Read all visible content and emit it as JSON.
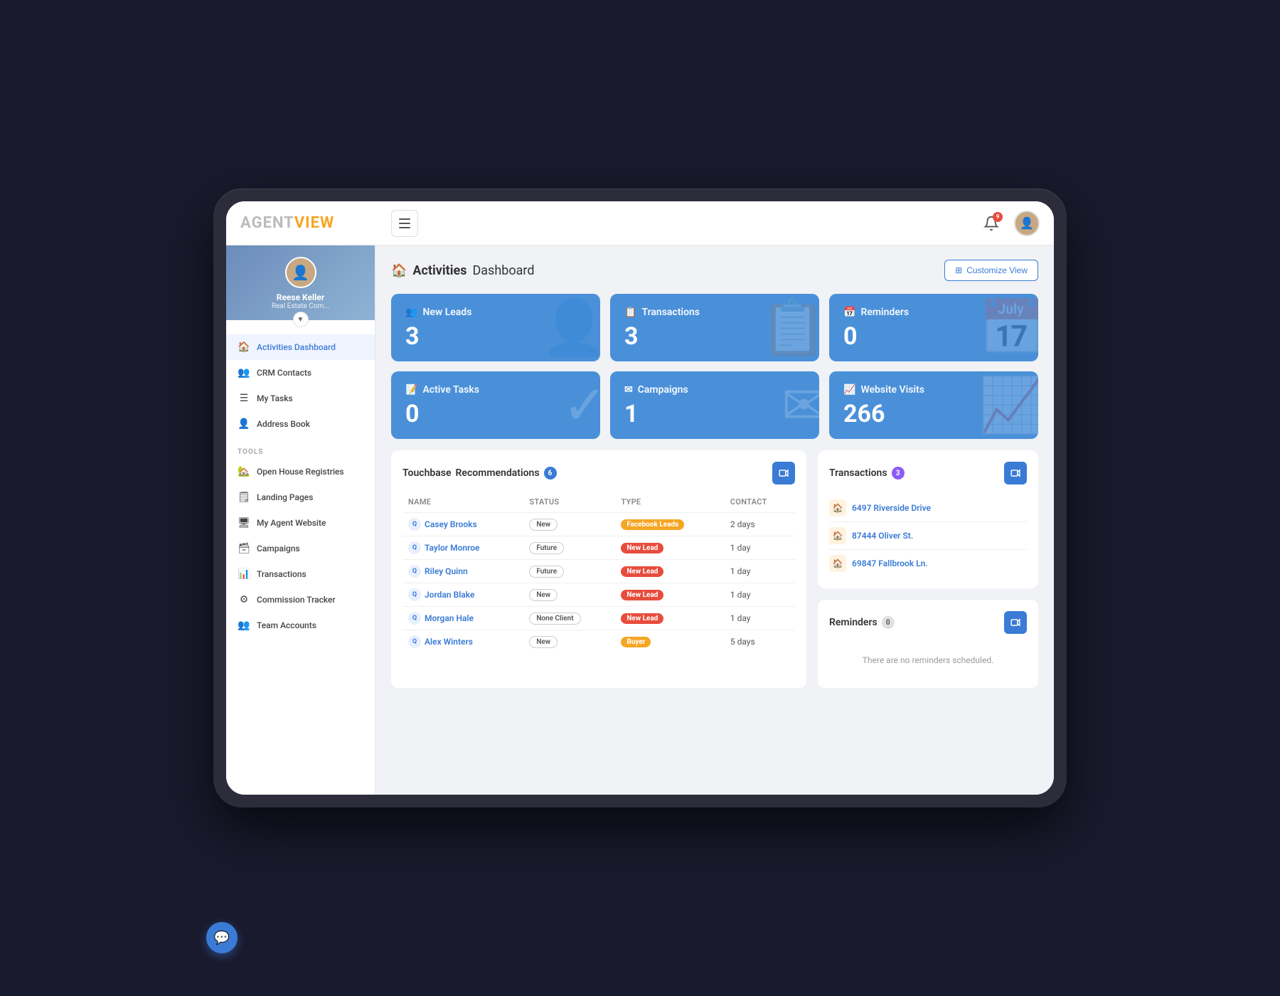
{
  "app": {
    "logo_agent": "AGENT",
    "logo_view": "VIEW"
  },
  "topbar": {
    "notification_count": "9",
    "user_avatar_emoji": "👤"
  },
  "sidebar": {
    "user": {
      "name": "Reese Keller",
      "role": "Real Estate Com...",
      "avatar_emoji": "👤"
    },
    "expand_icon": "▼",
    "nav_items": [
      {
        "id": "activities-dashboard",
        "label": "Activities Dashboard",
        "icon": "🏠",
        "active": true
      },
      {
        "id": "crm-contacts",
        "label": "CRM Contacts",
        "icon": "👥",
        "active": false
      },
      {
        "id": "my-tasks",
        "label": "My Tasks",
        "icon": "☰",
        "active": false
      },
      {
        "id": "address-book",
        "label": "Address Book",
        "icon": "👤",
        "active": false
      }
    ],
    "tools_label": "TOOLS",
    "tool_items": [
      {
        "id": "open-house",
        "label": "Open House Registries",
        "icon": "🏡"
      },
      {
        "id": "landing-pages",
        "label": "Landing Pages",
        "icon": "🗒"
      },
      {
        "id": "agent-website",
        "label": "My Agent Website",
        "icon": "🖥"
      },
      {
        "id": "campaigns",
        "label": "Campaigns",
        "icon": "🗃"
      },
      {
        "id": "transactions",
        "label": "Transactions",
        "icon": "📊"
      },
      {
        "id": "commission-tracker",
        "label": "Commission Tracker",
        "icon": "⚙"
      },
      {
        "id": "team-accounts",
        "label": "Team Accounts",
        "icon": "👥"
      }
    ]
  },
  "page": {
    "title_bold": "Activities",
    "title_light": "Dashboard",
    "home_icon": "🏠",
    "customize_btn": "Customize View",
    "customize_icon": "⊞"
  },
  "stats": [
    {
      "id": "new-leads",
      "label": "New Leads",
      "value": "3",
      "icon": "👥"
    },
    {
      "id": "transactions",
      "label": "Transactions",
      "value": "3",
      "icon": "📋"
    },
    {
      "id": "reminders",
      "label": "Reminders",
      "value": "0",
      "icon": "📅"
    },
    {
      "id": "active-tasks",
      "label": "Active Tasks",
      "value": "0",
      "icon": "📝"
    },
    {
      "id": "campaigns",
      "label": "Campaigns",
      "value": "1",
      "icon": "✉"
    },
    {
      "id": "website-visits",
      "label": "Website Visits",
      "value": "266",
      "icon": "📈"
    }
  ],
  "touchbase": {
    "title": "Touchbase",
    "subtitle": "Recommendations",
    "badge_count": "6",
    "columns": [
      "Name",
      "Status",
      "Type",
      "Contact"
    ],
    "rows": [
      {
        "name": "Casey Brooks",
        "status": "New",
        "status_type": "new",
        "type_label": "Facebook Leads",
        "type_style": "facebook",
        "contact": "2 days"
      },
      {
        "name": "Taylor Monroe",
        "status": "Future",
        "status_type": "future",
        "type_label": "New Lead",
        "type_style": "new-lead",
        "contact": "1 day"
      },
      {
        "name": "Riley Quinn",
        "status": "Future",
        "status_type": "future",
        "type_label": "New Lead",
        "type_style": "new-lead",
        "contact": "1 day"
      },
      {
        "name": "Jordan Blake",
        "status": "New",
        "status_type": "new",
        "type_label": "New Lead",
        "type_style": "new-lead",
        "contact": "1 day"
      },
      {
        "name": "Morgan Hale",
        "status": "None Client",
        "status_type": "none-client",
        "type_label": "New Lead",
        "type_style": "new-lead",
        "contact": "1 day"
      },
      {
        "name": "Alex Winters",
        "status": "New",
        "status_type": "new",
        "type_label": "Buyer",
        "type_style": "buyer",
        "contact": "5 days"
      }
    ]
  },
  "transactions_panel": {
    "title": "Transactions",
    "badge_count": "3",
    "items": [
      {
        "address": "6497 Riverside Drive"
      },
      {
        "address": "87444 Oliver St."
      },
      {
        "address": "69847 Fallbrook Ln."
      }
    ]
  },
  "reminders_panel": {
    "title": "Reminders",
    "badge_count": "0",
    "empty_text": "There are no reminders scheduled."
  },
  "chat_fab_icon": "💬"
}
